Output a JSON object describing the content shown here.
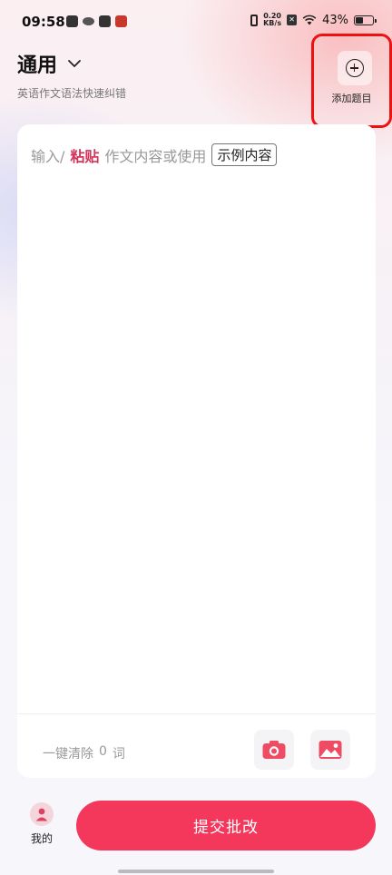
{
  "status_bar": {
    "time": "09:58",
    "net_speed_value": "0.20",
    "net_speed_unit": "KB/s",
    "battery_percent": "43%",
    "battery_level": 0.43
  },
  "header": {
    "mode_title": "通用",
    "subtitle": "英语作文语法快速纠错",
    "add_topic_label": "添加题目"
  },
  "editor": {
    "prompt_prefix": "输入/",
    "paste_label": "粘贴",
    "prompt_middle": "作文内容或使用",
    "example_button": "示例内容",
    "clear_label": "一键清除",
    "word_count": "0",
    "word_unit": "词"
  },
  "bottom_bar": {
    "mine_label": "我的",
    "submit_label": "提交批改"
  },
  "colors": {
    "accent": "#f3385c",
    "paste_link": "#d2355b",
    "highlight_box": "#ee1111"
  },
  "icons": [
    "chevron-down-icon",
    "plus-circle-icon",
    "camera-icon",
    "image-icon",
    "user-icon",
    "wifi-icon",
    "battery-icon"
  ]
}
